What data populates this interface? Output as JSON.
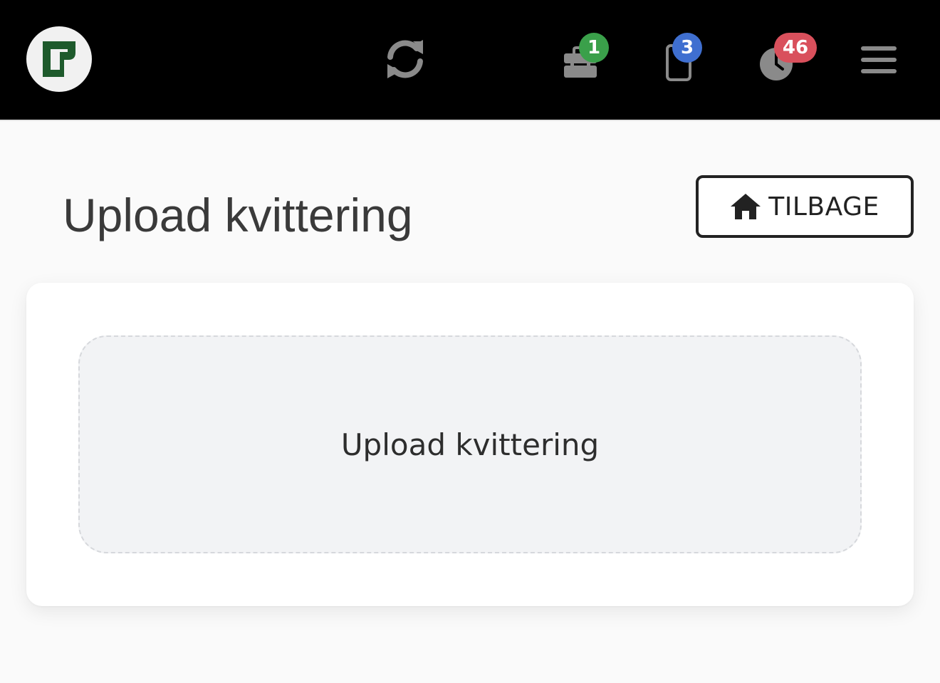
{
  "colors": {
    "topbar_bg": "#000000",
    "page_bg": "#fafafa",
    "icon_gray": "#8a8a8a",
    "badge_green": "#3aa04a",
    "badge_blue": "#3f6fd0",
    "badge_red": "#d9505c",
    "logo_green": "#1e5a2c"
  },
  "header": {
    "icons": [
      "logo-icon",
      "sync-icon",
      "toolbox-icon",
      "phone-icon",
      "clock-icon",
      "hamburger-menu-icon"
    ],
    "badges": {
      "toolbox": "1",
      "phone": "3",
      "clock": "46"
    }
  },
  "page": {
    "title": "Upload kvittering",
    "back_button_label": "TILBAGE",
    "dropzone_label": "Upload kvittering"
  }
}
